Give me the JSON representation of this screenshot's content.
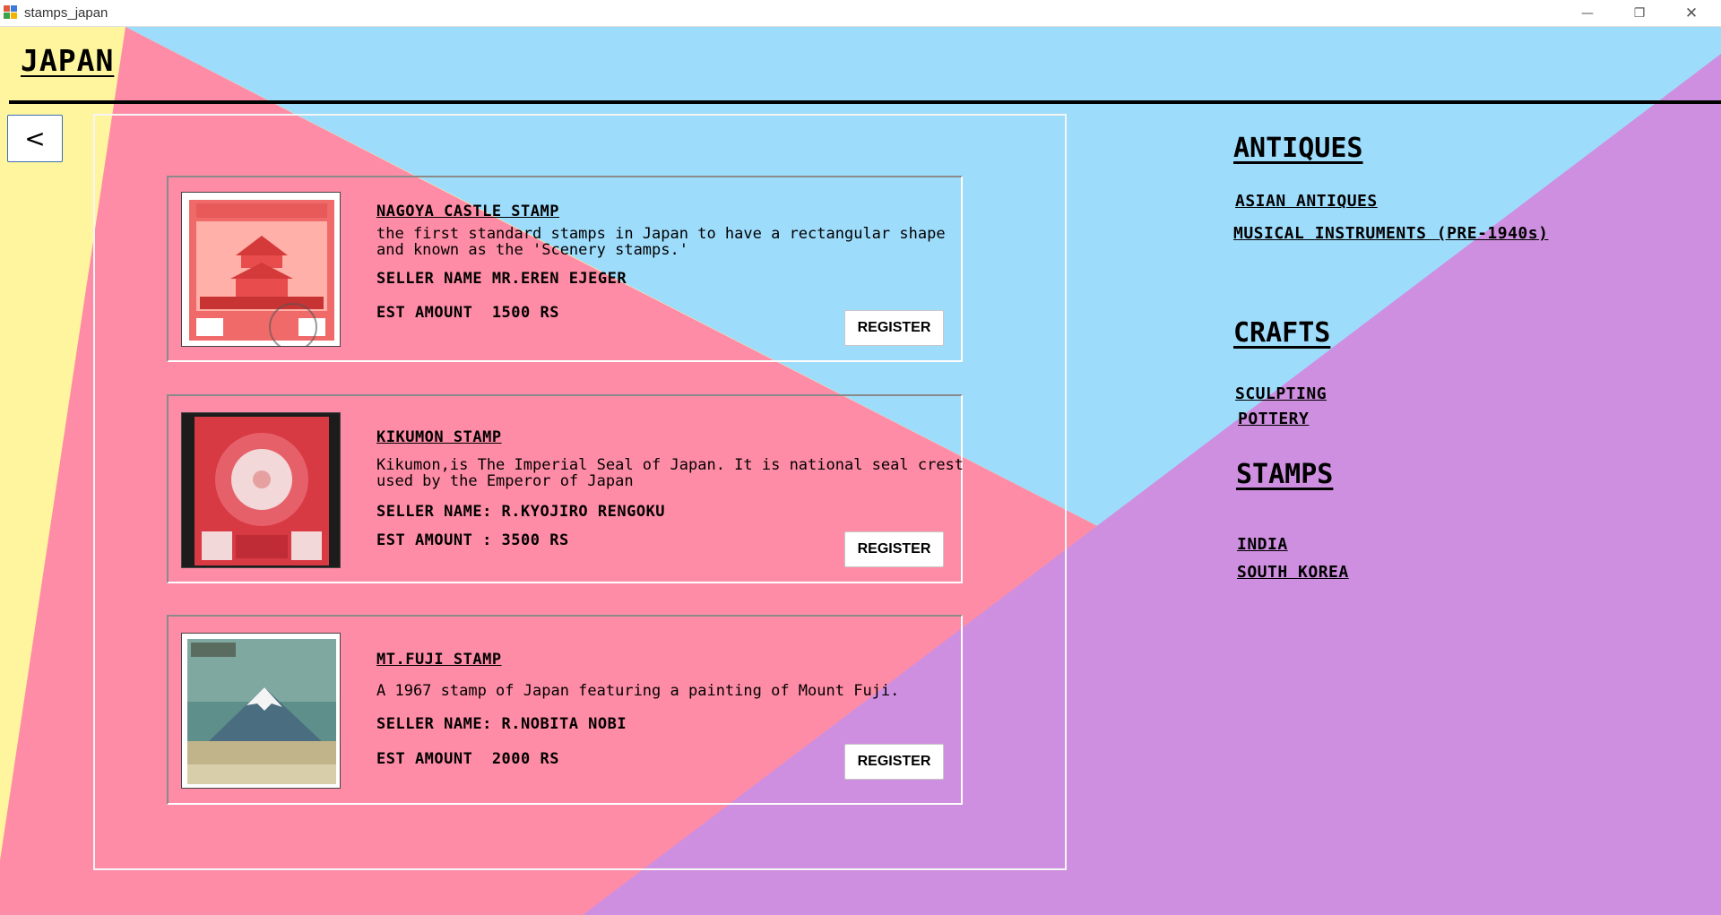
{
  "window": {
    "title": "stamps_japan",
    "controls": {
      "minimize": "—",
      "restore": "❐",
      "close": "✕"
    }
  },
  "colors": {
    "yellow": "#fff59e",
    "blue": "#9edcfc",
    "pink": "#ff8ca6",
    "purple": "#cf8fe0"
  },
  "page": {
    "title": "JAPAN",
    "back_label": "<"
  },
  "listings": [
    {
      "name": "NAGOYA CASTLE STAMP",
      "description": "the first standard stamps in Japan to have a rectangular shape and known as the 'Scenery stamps.'",
      "seller": "SELLER NAME MR.EREN EJEGER",
      "amount": "EST AMOUNT  1500 RS",
      "register_label": "REGISTER",
      "stamp_icon": "nagoya-castle-stamp-image"
    },
    {
      "name": "KIKUMON STAMP",
      "description": "Kikumon,is The Imperial Seal of Japan. It is national seal crest used by the Emperor of Japan",
      "seller": "SELLER NAME: R.KYOJIRO RENGOKU",
      "amount": "EST AMOUNT : 3500 RS",
      "register_label": "REGISTER",
      "stamp_icon": "kikumon-stamp-image"
    },
    {
      "name": "MT.FUJI STAMP",
      "description": "A 1967 stamp of Japan featuring a painting of Mount Fuji.",
      "seller": "SELLER NAME: R.NOBITA NOBI",
      "amount": "EST AMOUNT  2000 RS",
      "register_label": "REGISTER",
      "stamp_icon": "mt-fuji-stamp-image"
    }
  ],
  "categories": {
    "antiques": {
      "heading": "ANTIQUES",
      "links": [
        "ASIAN ANTIQUES",
        "MUSICAL INSTRUMENTS (PRE-1940s)"
      ]
    },
    "crafts": {
      "heading": "CRAFTS",
      "links": [
        "SCULPTING",
        "POTTERY"
      ]
    },
    "stamps": {
      "heading": "STAMPS",
      "links": [
        "INDIA",
        "SOUTH KOREA"
      ]
    }
  }
}
